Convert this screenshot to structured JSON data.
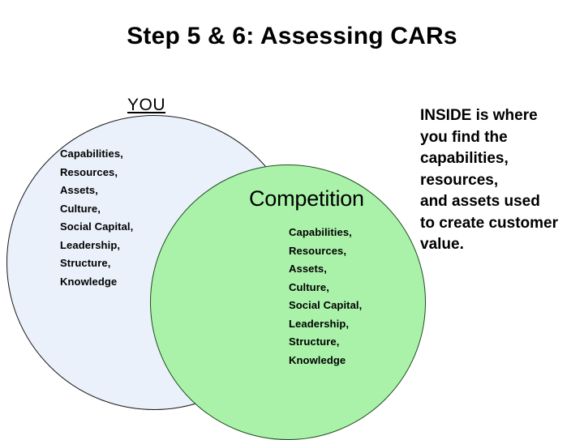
{
  "slide": {
    "title": "Step 5 & 6: Assessing CARs",
    "background_color": "#ffffff"
  },
  "venn": {
    "left_circle": {
      "label": "YOU",
      "fill_color": "#eaf1fa",
      "stroke_color": "#1a1a1a",
      "items": [
        "Capabilities,",
        "Resources,",
        "Assets,",
        "Culture,",
        "Social Capital,",
        "Leadership,",
        "Structure,",
        "Knowledge"
      ]
    },
    "right_circle": {
      "label": "Competition",
      "fill_color": "#aaf2aa",
      "stroke_color": "#1f4d1f",
      "items": [
        "Capabilities,",
        "Resources,",
        "Assets,",
        "Culture,",
        "Social Capital,",
        "Leadership,",
        "Structure,",
        "Knowledge"
      ]
    }
  },
  "note": {
    "lines": [
      "INSIDE is where",
      " you find the",
      "capabilities,",
      "resources,",
      "and assets used",
      "to create customer",
      "value."
    ]
  }
}
